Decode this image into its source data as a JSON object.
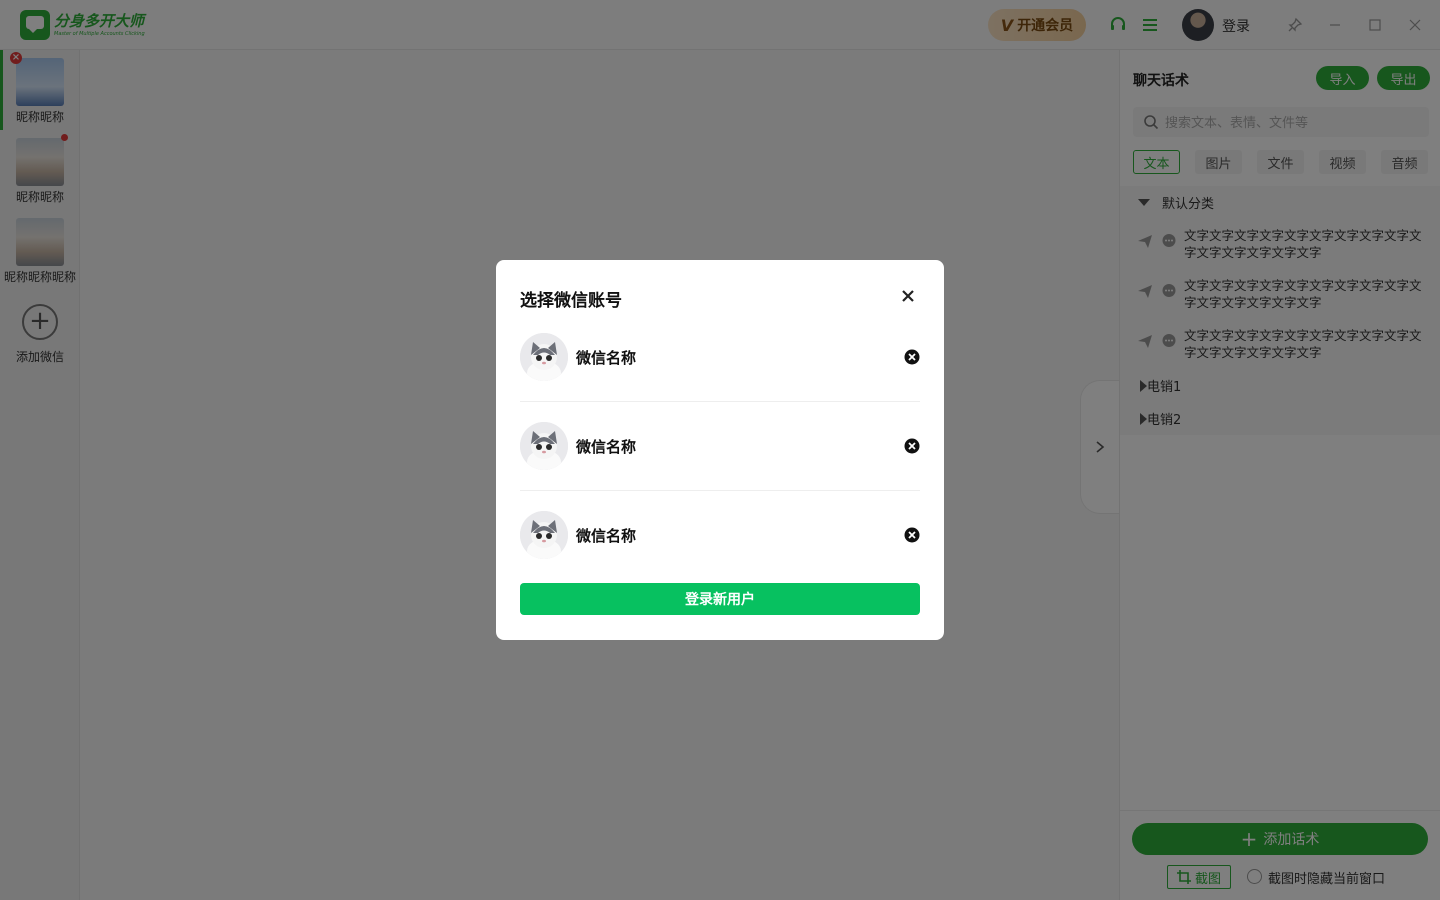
{
  "app": {
    "logo_title": "分身多开大师",
    "logo_subtitle": "Master of Multiple Accounts Clicking",
    "vip_label": "开通会员",
    "login_label": "登录",
    "icons": [
      "headset-icon",
      "menu-icon",
      "pin-icon",
      "minimize-icon",
      "maximize-icon",
      "close-icon"
    ]
  },
  "accounts": [
    {
      "name": "昵称昵称",
      "active": true,
      "has_close": true
    },
    {
      "name": "昵称昵称",
      "active": false,
      "unread_dot": true
    },
    {
      "name": "昵称昵称昵称",
      "active": false
    }
  ],
  "add_account_label": "添加微信",
  "panel": {
    "title": "聊天话术",
    "import_label": "导入",
    "export_label": "导出",
    "search_placeholder": "搜索文本、表情、文件等",
    "tabs": [
      {
        "label": "文本",
        "active": true
      },
      {
        "label": "图片"
      },
      {
        "label": "文件"
      },
      {
        "label": "视频"
      },
      {
        "label": "音频"
      }
    ],
    "default_category": "默认分类",
    "items": [
      "文字文字文字文字文字文字文字文字文字文字文字文字文字文字文字",
      "文字文字文字文字文字文字文字文字文字文字文字文字文字文字文字",
      "文字文字文字文字文字文字文字文字文字文字文字文字文字文字文字"
    ],
    "categories": [
      "电销1",
      "电销2"
    ],
    "add_script_label": "添加话术",
    "screenshot_label": "截图",
    "hide_window_label": "截图时隐藏当前窗口"
  },
  "dialog": {
    "title": "选择微信账号",
    "accounts": [
      "微信名称",
      "微信名称",
      "微信名称"
    ],
    "login_new_label": "登录新用户"
  },
  "colors": {
    "brand_green": "#2fae3b",
    "primary_button": "#07c160",
    "vip_gold": "#f3cf9d"
  }
}
